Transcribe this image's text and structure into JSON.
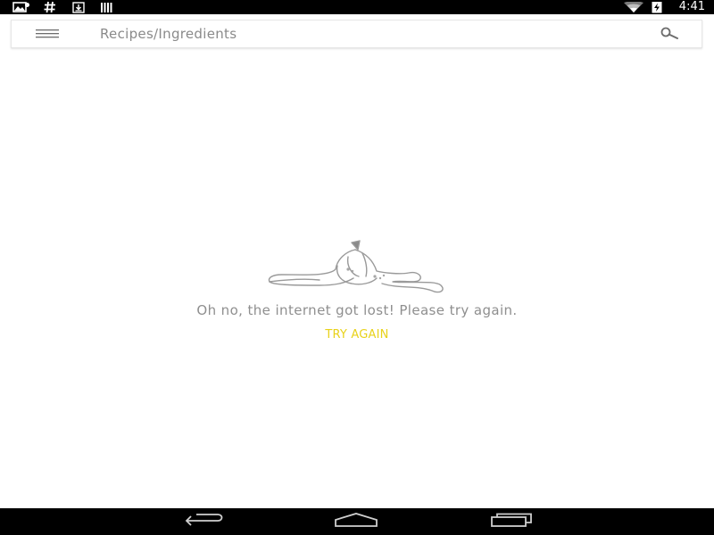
{
  "status_bar": {
    "time": "4:41",
    "icons": [
      "image-notification-icon",
      "hashtag-notification-icon",
      "download-notification-icon",
      "barcode-notification-icon",
      "wifi-icon",
      "battery-charging-icon"
    ]
  },
  "toolbar": {
    "title": "Recipes/Ingredients",
    "menu_icon": "hamburger-menu-icon",
    "search_icon": "search-icon"
  },
  "error_state": {
    "illustration": "banana-peel-illustration",
    "message": "Oh no, the internet got lost! Please try again.",
    "action_label": "TRY AGAIN",
    "action_color": "#e8d21a"
  },
  "nav_bar": {
    "icons": [
      "back-icon",
      "home-icon",
      "recents-icon"
    ]
  }
}
